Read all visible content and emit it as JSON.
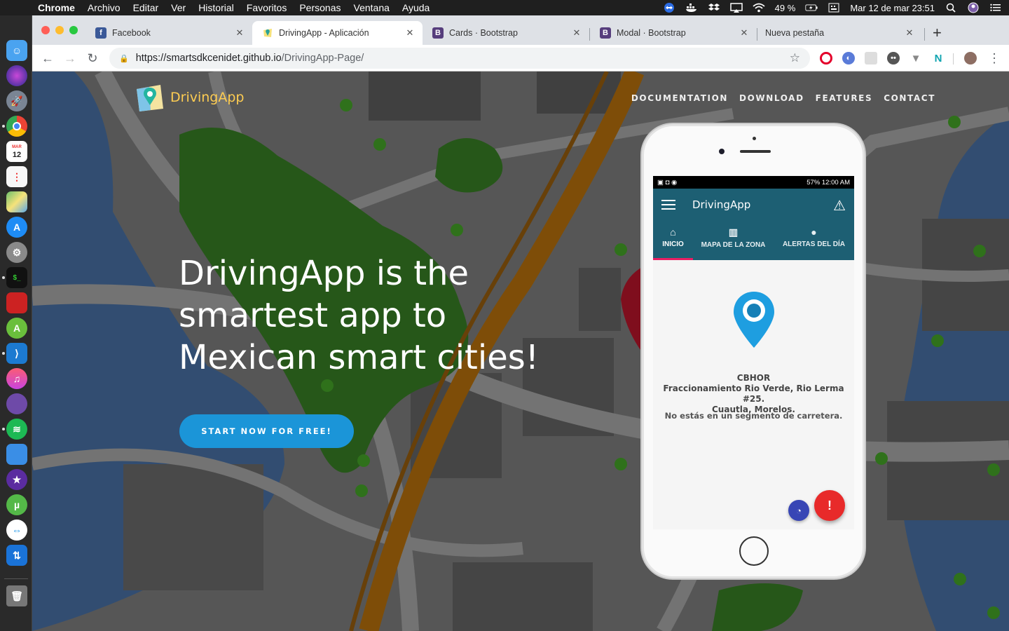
{
  "menubar": {
    "app_name": "Chrome",
    "menus": [
      "Archivo",
      "Editar",
      "Ver",
      "Historial",
      "Favoritos",
      "Personas",
      "Ventana",
      "Ayuda"
    ],
    "battery": "49 %",
    "datetime": "Mar 12 de mar  23:51"
  },
  "dock": {
    "icons": [
      "finder-icon",
      "siri-icon",
      "launchpad-icon",
      "chrome-icon",
      "calendar-icon",
      "reminders-icon",
      "maps-icon",
      "app-store-icon",
      "system-preferences-icon",
      "terminal-icon",
      "photo-booth-icon",
      "android-studio-icon",
      "vscode-icon",
      "itunes-icon",
      "github-desktop-icon",
      "spotify-icon",
      "keynote-icon",
      "imovie-icon",
      "utorrent-icon",
      "teamviewer-icon",
      "transmit-icon",
      "trash-icon"
    ],
    "calendar_day": "12",
    "calendar_month": "MAR"
  },
  "tabs": [
    {
      "title": "Facebook",
      "favicon": "f",
      "color": "#3b5998"
    },
    {
      "title": "DrivingApp - Aplicación",
      "favicon": "",
      "color": "#2aa198"
    },
    {
      "title": "Cards · Bootstrap",
      "favicon": "B",
      "color": "#563d7c"
    },
    {
      "title": "Modal · Bootstrap",
      "favicon": "B",
      "color": "#563d7c"
    },
    {
      "title": "Nueva pestaña",
      "favicon": "",
      "color": "#dee1e6"
    }
  ],
  "address_bar": {
    "host": "https://smartsdkcenidet.github.io",
    "path": "/DrivingApp-Page/"
  },
  "site": {
    "brand": "DrivingApp",
    "nav": [
      "DOCUMENTATION",
      "DOWNLOAD",
      "FEATURES",
      "CONTACT"
    ],
    "headline_lines": [
      "DrivingApp is the",
      "smartest app to",
      "Mexican smart cities!"
    ],
    "cta": "START NOW FOR FREE!"
  },
  "app": {
    "status_right": "57% 12:00 AM",
    "title": "DrivingApp",
    "tabs": [
      "INICIO",
      "MAPA DE LA ZONA",
      "ALERTAS DEL DÍA"
    ],
    "address_lines": [
      "CBHOR",
      "Fraccionamiento Rio Verde, Rio Lerma #25.",
      "Cuautla, Morelos."
    ],
    "segment_text": "No estás en un segmento de carretera."
  }
}
